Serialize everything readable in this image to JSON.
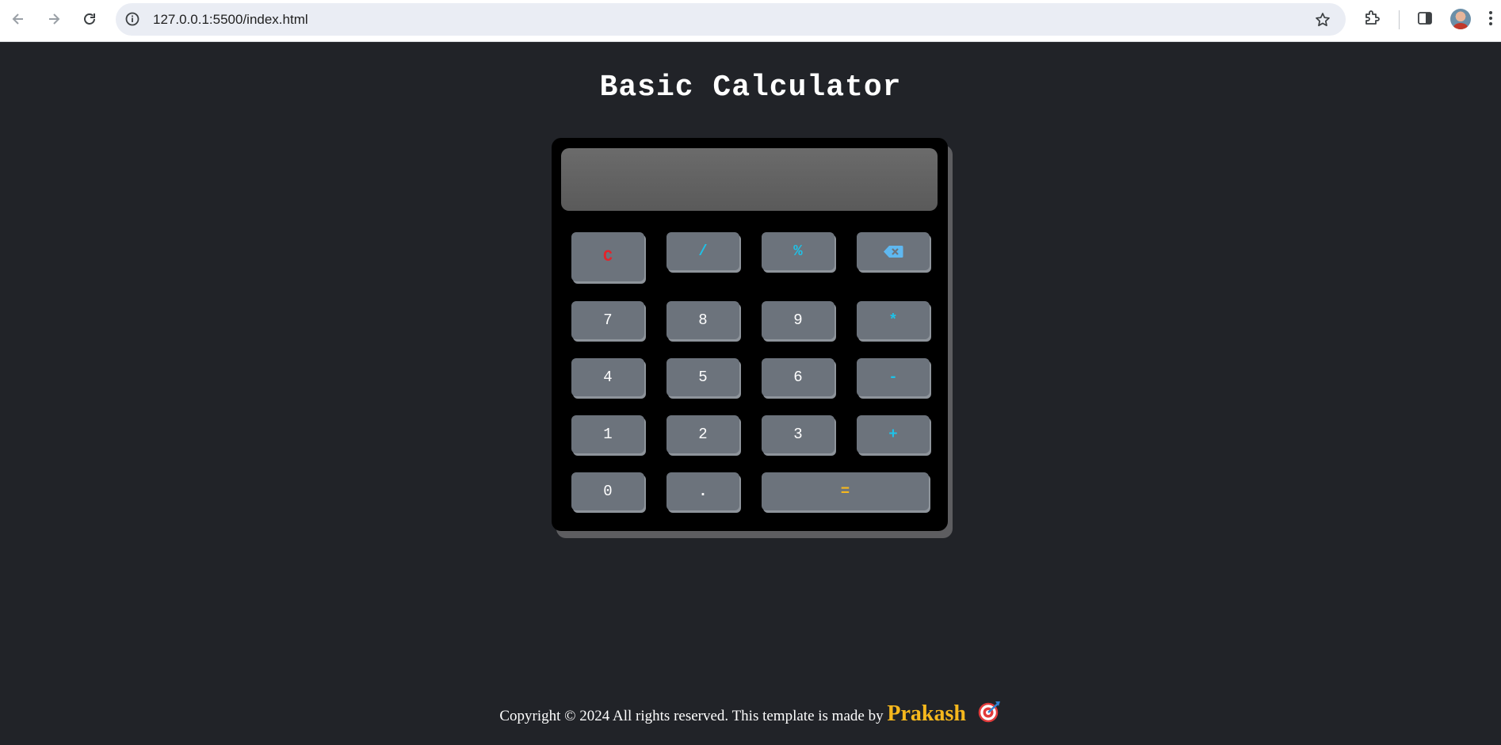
{
  "browser": {
    "url": "127.0.0.1:5500/index.html"
  },
  "page": {
    "title": "Basic Calculator"
  },
  "calculator": {
    "display_value": "",
    "keys": {
      "clear": "C",
      "divide": "/",
      "percent": "%",
      "seven": "7",
      "eight": "8",
      "nine": "9",
      "multiply": "*",
      "four": "4",
      "five": "5",
      "six": "6",
      "minus": "-",
      "one": "1",
      "two": "2",
      "three": "3",
      "plus": "+",
      "zero": "0",
      "dot": ".",
      "equals": "="
    },
    "colors": {
      "body_bg": "#000000",
      "display_bg": "#666666",
      "key_bg": "#6c737c",
      "operator": "#1ec2e8",
      "clear": "#e3242b",
      "equals": "#f6b81d",
      "page_bg": "#212328"
    }
  },
  "footer": {
    "text": "Copyright © 2024 All rights reserved. This template is made by",
    "author": "Prakash",
    "icon": "dart-target-icon"
  }
}
